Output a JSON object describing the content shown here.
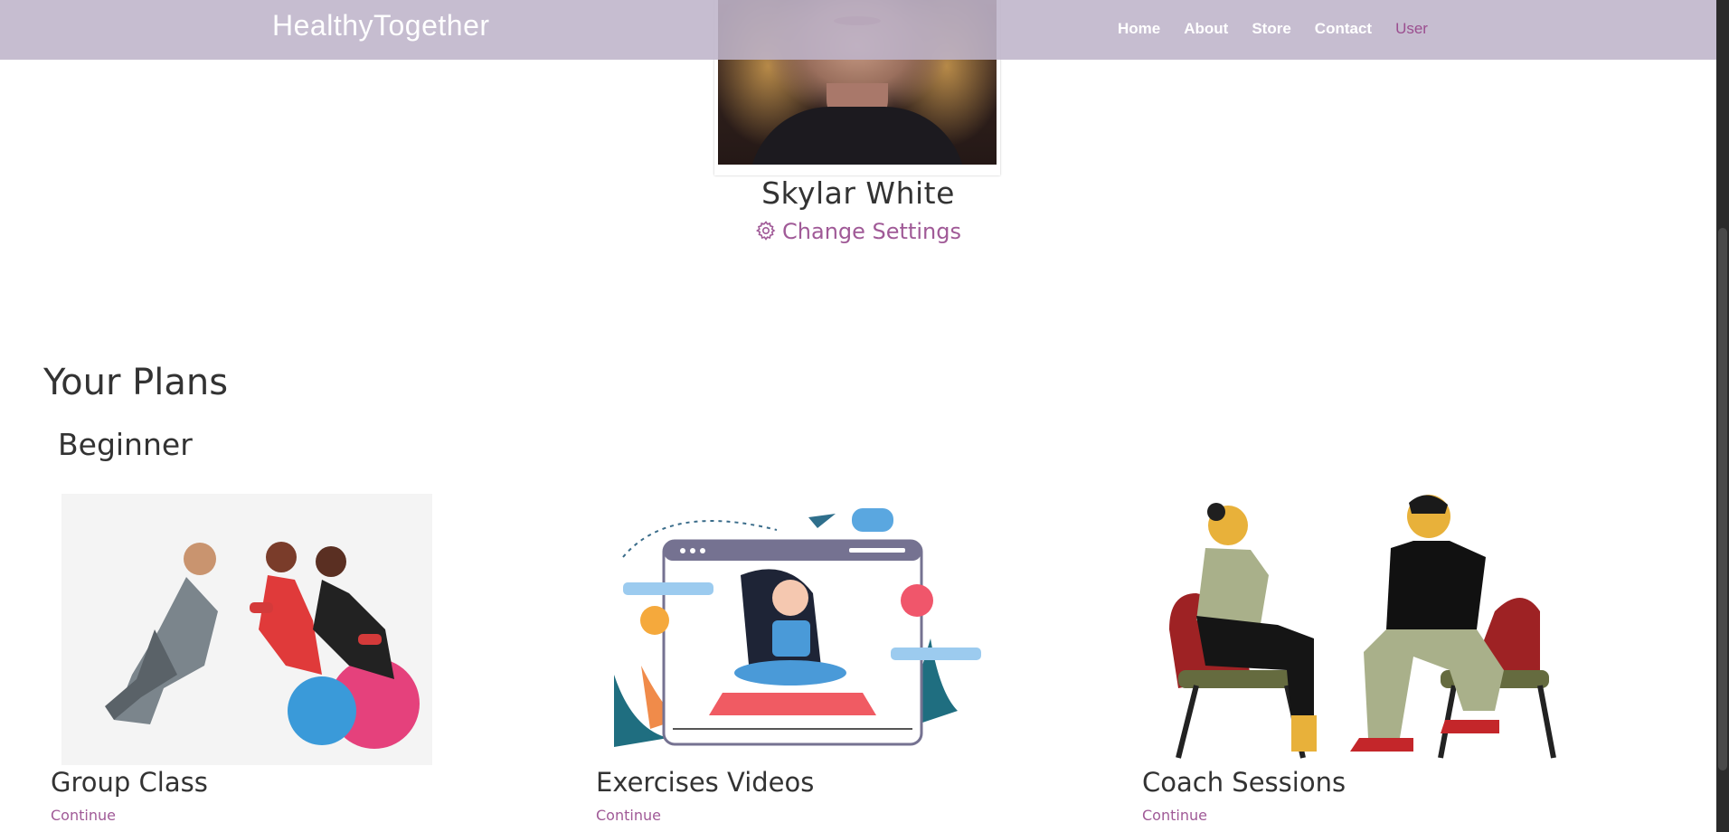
{
  "nav": {
    "brand": "HealthyTogether",
    "links": [
      "Home",
      "About",
      "Store",
      "Contact",
      "User"
    ],
    "active_link": "User"
  },
  "profile": {
    "name": "Skylar White",
    "settings_label": "Change Settings",
    "settings_icon": "gear-icon"
  },
  "plans": {
    "section_title": "Your Plans",
    "level": "Beginner",
    "cards": [
      {
        "title": "Group Class",
        "action": "Continue",
        "image": "group-class-photo"
      },
      {
        "title": "Exercises Videos",
        "action": "Continue",
        "image": "exercise-video-illustration"
      },
      {
        "title": "Coach Sessions",
        "action": "Continue",
        "image": "coach-session-illustration"
      }
    ]
  },
  "colors": {
    "nav_bg": "#beb4ca",
    "accent": "#a05a97",
    "heading": "#333333"
  }
}
